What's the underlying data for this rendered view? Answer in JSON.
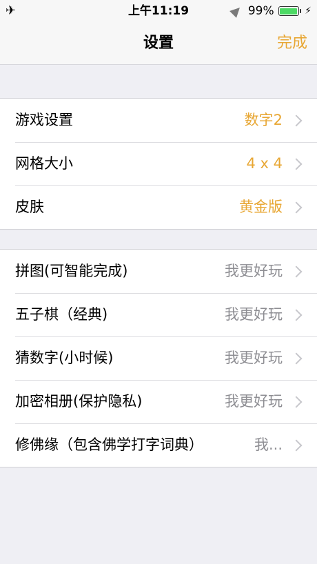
{
  "status_bar": {
    "left_icon": "airplane-icon",
    "time": "上午11:19",
    "battery_percent": "99%",
    "battery_level": 0.99,
    "charging": true
  },
  "nav": {
    "title": "设置",
    "done": "完成"
  },
  "colors": {
    "accent": "#e8a734",
    "secondary_text": "#8e8e93",
    "background": "#efeff4"
  },
  "group1": [
    {
      "label": "游戏设置",
      "value": "数字2"
    },
    {
      "label": "网格大小",
      "value": "4 x 4"
    },
    {
      "label": "皮肤",
      "value": "黄金版"
    }
  ],
  "group2": [
    {
      "label": "拼图(可智能完成)",
      "value": "我更好玩"
    },
    {
      "label": "五子棋（经典)",
      "value": "我更好玩"
    },
    {
      "label": "猜数字(小时候)",
      "value": "我更好玩"
    },
    {
      "label": "加密相册(保护隐私)",
      "value": "我更好玩"
    },
    {
      "label": "修佛缘（包含佛学打字词典）",
      "value": "我..."
    }
  ]
}
